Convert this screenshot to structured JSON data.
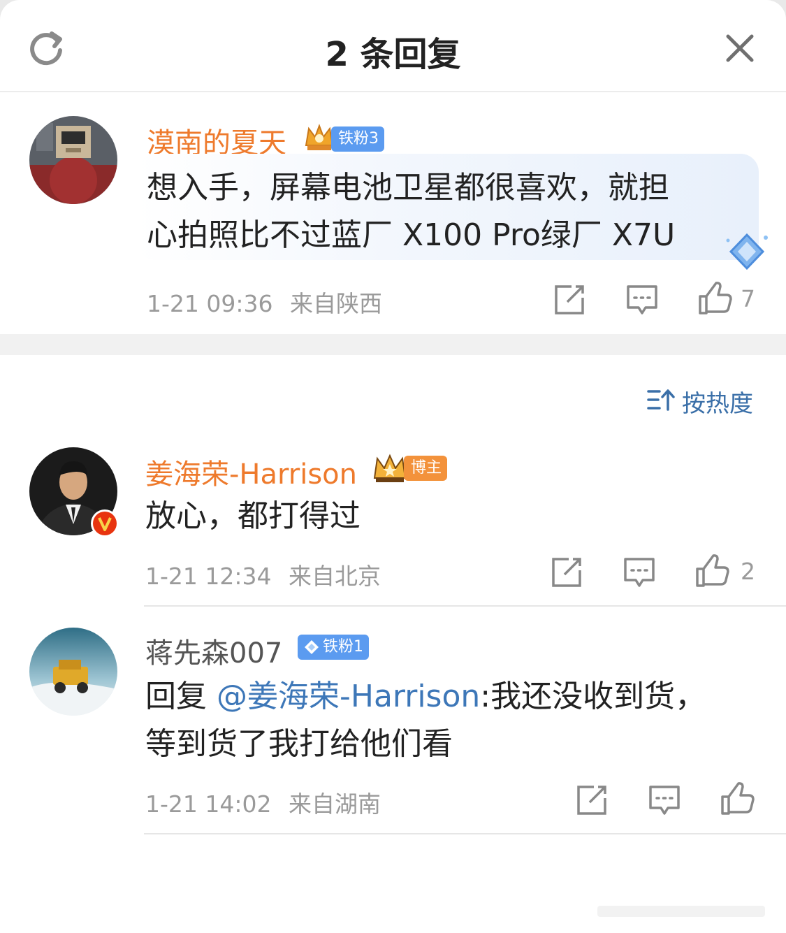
{
  "header": {
    "title": "2 条回复"
  },
  "root_comment": {
    "name": "漠南的夏天",
    "badge": "铁粉3",
    "text_line1": "想入手，屏幕电池卫星都很喜欢，就担",
    "text_line2": "心拍照比不过蓝厂 X100 Pro绿厂 X7U",
    "time": "1-21 09:36",
    "location": "来自陕西",
    "likes": "7"
  },
  "sort": {
    "label": "按热度"
  },
  "replies": [
    {
      "name": "姜海荣-Harrison",
      "badge": "博主",
      "text_line1": "放心，都打得过",
      "time": "1-21 12:34",
      "location": "来自北京",
      "likes": "2"
    },
    {
      "name": "蒋先森007",
      "badge": "铁粉1",
      "reply_prefix": "回复 ",
      "mention": "@姜海荣-Harrison",
      "text_rest": ":我还没收到货，",
      "text_line2": "等到货了我打给他们看",
      "time": "1-21 14:02",
      "location": "来自湖南",
      "likes": ""
    }
  ],
  "colors": {
    "name_orange": "#ee7a2c",
    "name_gray": "#555555",
    "link_blue": "#3d77b8",
    "badge_blue": "#5b9bf0",
    "badge_orange": "#f3923b",
    "meta_gray": "#9a9a9a"
  },
  "icons": [
    "refresh-icon",
    "close-icon",
    "share-icon",
    "comment-icon",
    "like-icon",
    "sort-icon",
    "verified-icon",
    "crown-icon",
    "diamond-icon"
  ]
}
